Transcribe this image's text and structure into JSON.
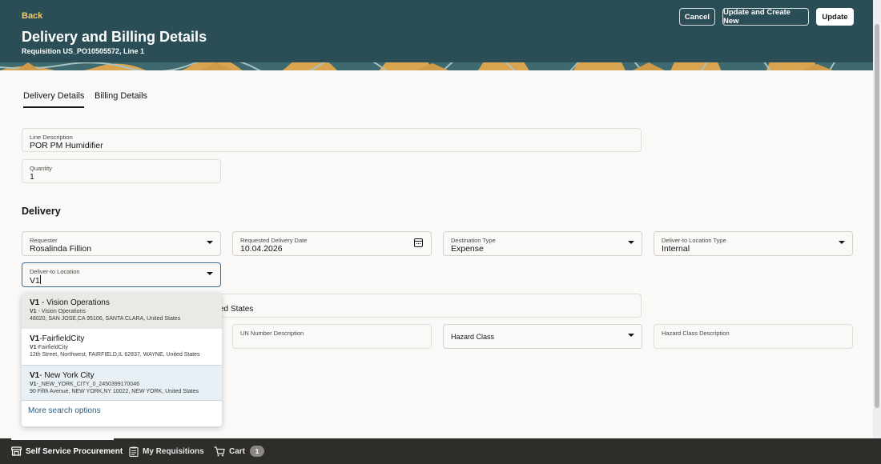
{
  "header": {
    "back_label": "Back",
    "title": "Delivery and Billing Details",
    "subtitle": "Requisition US_PO10505572, Line 1",
    "buttons": {
      "cancel": "Cancel",
      "update_create_new": "Update and Create New",
      "update": "Update"
    }
  },
  "tabs": [
    {
      "label": "Delivery Details",
      "active": true
    },
    {
      "label": "Billing Details",
      "active": false
    }
  ],
  "line": {
    "description_label": "Line Description",
    "description_value": "POR PM Humidifier",
    "quantity_label": "Quantity",
    "quantity_value": "1"
  },
  "delivery": {
    "section_title": "Delivery",
    "requester": {
      "label": "Requester",
      "value": "Rosalinda Fillion"
    },
    "requested_date": {
      "label": "Requested Delivery Date",
      "value": "10.04.2026"
    },
    "destination_type": {
      "label": "Destination Type",
      "value": "Expense"
    },
    "location_type": {
      "label": "Deliver-to Location Type",
      "value": "Internal"
    },
    "deliver_to_location": {
      "label": "Deliver-to Location",
      "value": "V1"
    },
    "address_partial": "ed States",
    "un_number_description": {
      "label": "UN Number Description"
    },
    "hazard_class": {
      "label": "Hazard Class"
    },
    "hazard_class_description": {
      "label": "Hazard Class Description"
    }
  },
  "dropdown": {
    "options": [
      {
        "code": "V1",
        "name": " - Vision Operations",
        "sub_code": "V1",
        "sub_name": " - Vision Operations",
        "address": "48020, SAN JOSE,CA 95106, SANTA CLARA, United States"
      },
      {
        "code": "V1",
        "name": "-FairfieldCity",
        "sub_code": "V1",
        "sub_name": "-FairfieldCity",
        "address": "12th Street, Northwest, FAIRFIELD,IL 62837, WAYNE, United States"
      },
      {
        "code": "V1",
        "name": "- New York City",
        "sub_code": "V1",
        "sub_name": "-_NEW_YORK_CITY_0_2450399170046",
        "address": "90 Fifth Avenue, NEW YORK,NY 10022, NEW YORK, United States"
      }
    ],
    "more_label": "More search options"
  },
  "footer": {
    "items": [
      {
        "label": "Self Service Procurement",
        "icon": "store-icon"
      },
      {
        "label": "My Requisitions",
        "icon": "clipboard-icon"
      },
      {
        "label": "Cart",
        "icon": "cart-icon",
        "badge": "1"
      }
    ]
  },
  "colors": {
    "header_bg": "#2b4e56",
    "back_link": "#f0cc71",
    "footer_bg": "#2f2d2a",
    "link": "#2b5d7d",
    "focus_border": "#3f6a92"
  }
}
